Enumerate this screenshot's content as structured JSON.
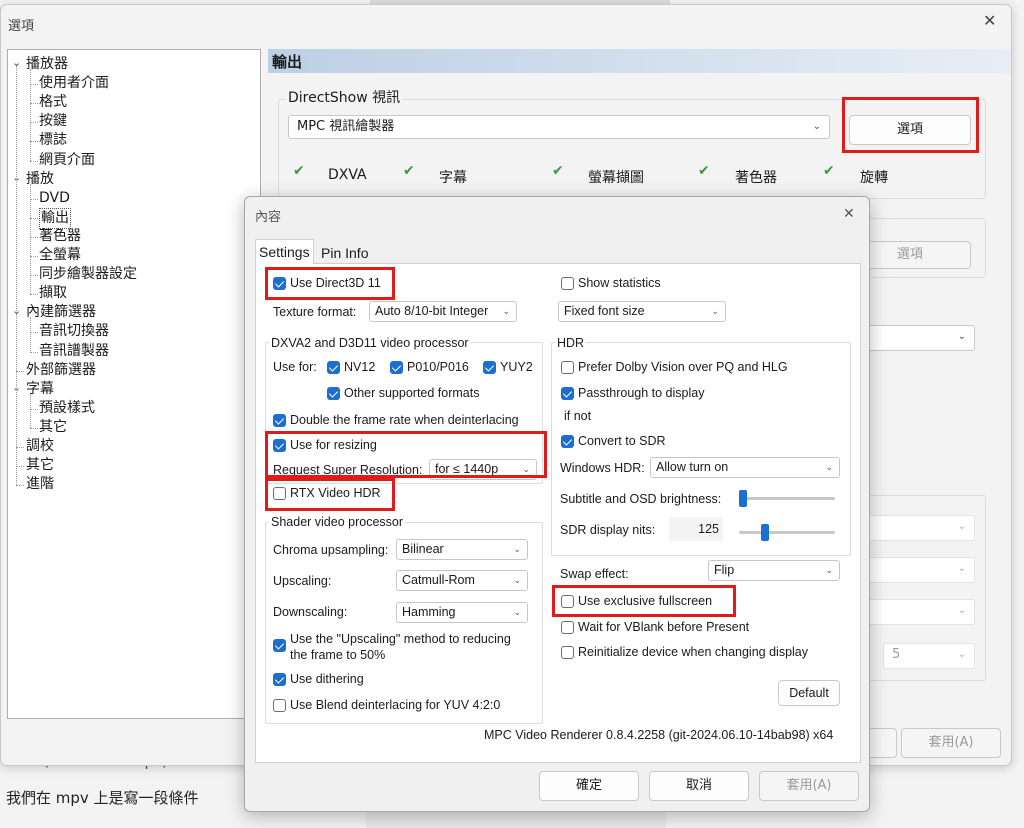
{
  "background": {
    "code_fragment": "' 3D  /   for ≤ 720p  /",
    "text_fragment": "我們在 mpv 上是寫一段條件",
    "top_fragment": "..."
  },
  "options_window": {
    "title": "選項",
    "close_glyph": "✕",
    "tree": [
      {
        "label": "播放器",
        "level": 0,
        "expand": "⌄"
      },
      {
        "label": "使用者介面",
        "level": 1
      },
      {
        "label": "格式",
        "level": 1
      },
      {
        "label": "按鍵",
        "level": 1
      },
      {
        "label": "標誌",
        "level": 1
      },
      {
        "label": "網頁介面",
        "level": 1
      },
      {
        "label": "播放",
        "level": 0,
        "expand": "⌄"
      },
      {
        "label": "DVD",
        "level": 1
      },
      {
        "label": "輸出",
        "level": 1,
        "selected": true
      },
      {
        "label": "著色器",
        "level": 1
      },
      {
        "label": "全螢幕",
        "level": 1
      },
      {
        "label": "同步繪製器設定",
        "level": 1
      },
      {
        "label": "擷取",
        "level": 1
      },
      {
        "label": "內建篩選器",
        "level": 0,
        "expand": "⌄"
      },
      {
        "label": "音訊切換器",
        "level": 1
      },
      {
        "label": "音訊譜製器",
        "level": 1
      },
      {
        "label": "外部篩選器",
        "level": 0
      },
      {
        "label": "字幕",
        "level": 0,
        "expand": "⌄"
      },
      {
        "label": "預設樣式",
        "level": 1
      },
      {
        "label": "其它",
        "level": 1
      },
      {
        "label": "調校",
        "level": 0
      },
      {
        "label": "其它",
        "level": 0
      },
      {
        "label": "進階",
        "level": 0
      }
    ],
    "page_header": "輸出",
    "directshow_group": "DirectShow 視訊",
    "renderer_combo": "MPC 視訊繪製器",
    "options_button": "選項",
    "options_button2": "選項",
    "features": [
      "DXVA",
      "字幕",
      "螢幕擷圖",
      "著色器",
      "旋轉"
    ],
    "check_glyph": "✔",
    "combo_value_5": "5",
    "apply_button": "套用(A)"
  },
  "dialog": {
    "title": "內容",
    "close_glyph": "✕",
    "tabs": [
      "Settings",
      "Pin Info"
    ],
    "use_d3d11": "Use Direct3D 11",
    "texture_format_label": "Texture format:",
    "texture_format_value": "Auto 8/10-bit Integer",
    "dxva_group": "DXVA2 and D3D11 video processor",
    "use_for_label": "Use for:",
    "nv12": "NV12",
    "p010": "P010/P016",
    "yuy2": "YUY2",
    "other_formats": "Other supported formats",
    "double_rate": "Double the frame rate when deinterlacing",
    "use_resizing": "Use for resizing",
    "super_res_label": "Request Super Resolution:",
    "super_res_value": "for ≤ 1440p",
    "rtx_hdr": "RTX Video HDR",
    "shader_group": "Shader video processor",
    "chroma_label": "Chroma upsampling:",
    "chroma_value": "Bilinear",
    "upscaling_label": "Upscaling:",
    "upscaling_value": "Catmull-Rom",
    "downscaling_label": "Downscaling:",
    "downscaling_value": "Hamming",
    "use_upscaling_method_1": "Use the \"Upscaling\" method to reducing",
    "use_upscaling_method_2": "the frame to 50%",
    "use_dithering": "Use dithering",
    "blend_deint": "Use Blend deinterlacing for YUV 4:2:0",
    "show_stats": "Show statistics",
    "font_size_value": "Fixed font size",
    "hdr_group": "HDR",
    "prefer_dolby": "Prefer Dolby Vision over PQ and HLG",
    "passthrough": "Passthrough to display",
    "if_not": "if not",
    "convert_sdr": "Convert to SDR",
    "windows_hdr_label": "Windows HDR:",
    "windows_hdr_value": "Allow turn on",
    "subtitle_brightness": "Subtitle and OSD brightness:",
    "subtitle_brightness_level": 0.0,
    "sdr_nits_label": "SDR display nits:",
    "sdr_nits_value": "125",
    "sdr_nits_level": 0.25,
    "swap_label": "Swap effect:",
    "swap_value": "Flip",
    "exclusive_fs": "Use exclusive fullscreen",
    "wait_vblank": "Wait for VBlank before Present",
    "reinit": "Reinitialize device when changing display",
    "default_button": "Default",
    "version": "MPC Video Renderer 0.8.4.2258 (git-2024.06.10-14bab98) x64",
    "ok_button": "確定",
    "cancel_button": "取消",
    "apply_button": "套用(A)",
    "checks": {
      "use_d3d11": true,
      "nv12": true,
      "p010": true,
      "yuy2": true,
      "other_formats": true,
      "double_rate": true,
      "use_resizing": true,
      "rtx_hdr": false,
      "use_upscaling_method": true,
      "use_dithering": true,
      "blend_deint": false,
      "show_stats": false,
      "prefer_dolby": false,
      "passthrough": true,
      "convert_sdr": true,
      "exclusive_fs": false,
      "wait_vblank": false,
      "reinit": false
    }
  },
  "colors": {
    "highlight": "#e01b1b",
    "accent": "#1a6fd0",
    "check_green": "#3c9a3c"
  }
}
